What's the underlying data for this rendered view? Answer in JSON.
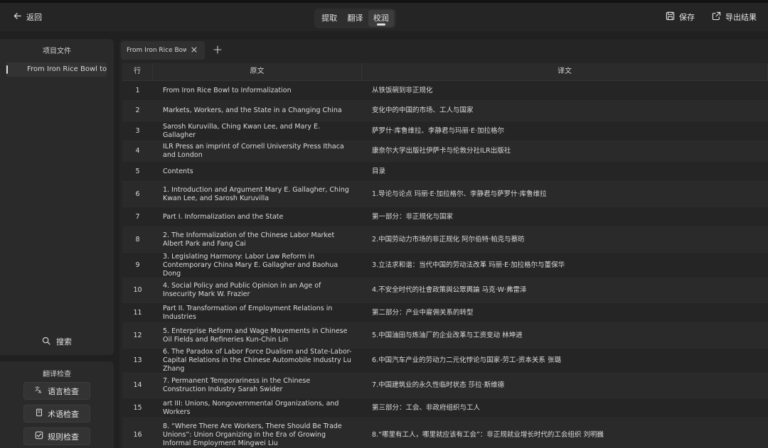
{
  "topbar": {
    "back_label": "返回",
    "tabs": [
      {
        "label": "提取",
        "active": false
      },
      {
        "label": "翻译",
        "active": false
      },
      {
        "label": "校润",
        "active": true
      }
    ],
    "save_label": "保存",
    "export_label": "导出结果"
  },
  "sidebar": {
    "title": "项目文件",
    "file_item": "From Iron Rice Bowl to ...",
    "search_label": "搜索"
  },
  "check_panel": {
    "title": "翻译检查",
    "buttons": [
      {
        "label": "语言检查",
        "icon": "language-icon"
      },
      {
        "label": "术语检查",
        "icon": "book-icon"
      },
      {
        "label": "规则检查",
        "icon": "checkbox-icon"
      }
    ]
  },
  "doc_tab": {
    "label": "From Iron Rice Bowl t"
  },
  "table": {
    "headers": {
      "row": "行",
      "source": "原文",
      "target": "译文"
    },
    "rows": [
      {
        "n": "1",
        "src": "From Iron Rice Bowl to Informalization",
        "tgt": "从铁饭碗到非正规化"
      },
      {
        "n": "2",
        "src": "Markets, Workers, and the State in a Changing China",
        "tgt": "变化中的中国的市场、工人与国家"
      },
      {
        "n": "3",
        "src": "Sarosh Kuruvilla, Ching Kwan Lee, and Mary E. Gallagher",
        "tgt": "萨罗什·库鲁维拉、李静君与玛丽·E·加拉格尔"
      },
      {
        "n": "4",
        "src": "ILR Press an imprint of Cornell University Press Ithaca and London",
        "tgt": "康奈尔大学出版社伊萨卡与伦敦分社ILR出版社"
      },
      {
        "n": "5",
        "src": "Contents",
        "tgt": "目录"
      },
      {
        "n": "6",
        "src": "1. Introduction and Argument Mary E. Gallagher, Ching Kwan Lee, and Sarosh Kuruvilla",
        "tgt": "1.导论与论点 玛丽·E·加拉格尔、李静君与萨罗什·库鲁维拉"
      },
      {
        "n": "7",
        "src": "Part I. Informalization and the State",
        "tgt": "第一部分：非正规化与国家"
      },
      {
        "n": "8",
        "src": "2. The Informalization of the Chinese Labor Market Albert Park and Fang Cai",
        "tgt": "2.中国劳动力市场的非正规化 阿尔伯特·帕克与蔡昉"
      },
      {
        "n": "9",
        "src": "3. Legislating Harmony: Labor Law Reform in Contemporary China Mary E. Gallagher and Baohua Dong",
        "tgt": "3.立法求和谐：当代中国的劳动法改革 玛丽·E·加拉格尔与董保华"
      },
      {
        "n": "10",
        "src": "4. Social Policy and Public Opinion in an Age of Insecurity Mark W. Frazier",
        "tgt": "4.不安全时代的社會政策與公眾輿論 马克·W·弗雷泽"
      },
      {
        "n": "11",
        "src": "Part II. Transformation of Employment Relations in Industries",
        "tgt": "第二部分：产业中雇佣关系的转型"
      },
      {
        "n": "12",
        "src": "5. Enterprise Reform and Wage Movements in Chinese Oil Fields and Refineries Kun-Chin Lin",
        "tgt": "5.中国油田与炼油厂的企业改革与工资变动 林坤进"
      },
      {
        "n": "13",
        "src": "6. The Paradox of Labor Force Dualism and State-Labor-Capital Relations in the Chinese Automobile Industry Lu Zhang",
        "tgt": "6.中国汽车产业的劳动力二元化悖论与国家-劳工-资本关系 张璐"
      },
      {
        "n": "14",
        "src": "7. Permanent Temporariness in the Chinese Construction Industry Sarah Swider",
        "tgt": "7.中国建筑业的永久性临时状态 莎拉·斯维德"
      },
      {
        "n": "15",
        "src": "art III: Unions, Nongovernmental Organizations, and Workers",
        "tgt": "第三部分：工会、非政府组织与工人"
      },
      {
        "n": "16",
        "src": "8. “Where There Are Workers, There Should Be Trade Unions”: Union Organizing in the Era of Growing Informal Employment Mingwei Liu",
        "tgt": "8.“哪里有工人，哪里就应该有工会”：非正规就业增长时代的工会组织 刘明巍"
      }
    ]
  }
}
